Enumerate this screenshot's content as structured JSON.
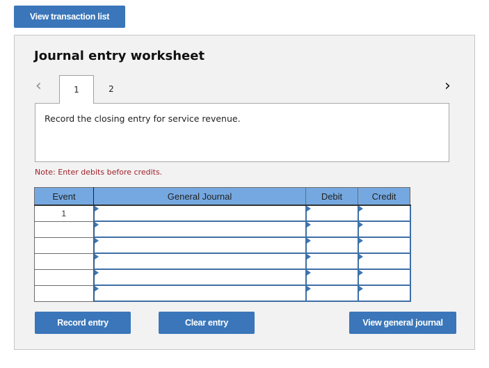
{
  "top": {
    "view_transaction_list": "View transaction list"
  },
  "worksheet": {
    "title": "Journal entry worksheet",
    "nav": {
      "prev_icon": "‹",
      "next_icon": "›"
    },
    "tabs": [
      {
        "label": "1",
        "active": true
      },
      {
        "label": "2",
        "active": false
      }
    ],
    "instruction": "Record the closing entry for service revenue.",
    "note": "Note: Enter debits before credits.",
    "table": {
      "headers": [
        "Event",
        "General Journal",
        "Debit",
        "Credit"
      ],
      "rows": [
        {
          "event": "1",
          "account": "",
          "debit": "",
          "credit": ""
        },
        {
          "event": "",
          "account": "",
          "debit": "",
          "credit": ""
        },
        {
          "event": "",
          "account": "",
          "debit": "",
          "credit": ""
        },
        {
          "event": "",
          "account": "",
          "debit": "",
          "credit": ""
        },
        {
          "event": "",
          "account": "",
          "debit": "",
          "credit": ""
        },
        {
          "event": "",
          "account": "",
          "debit": "",
          "credit": ""
        }
      ]
    },
    "buttons": {
      "record": "Record entry",
      "clear": "Clear entry",
      "view_general_journal": "View general journal"
    }
  }
}
